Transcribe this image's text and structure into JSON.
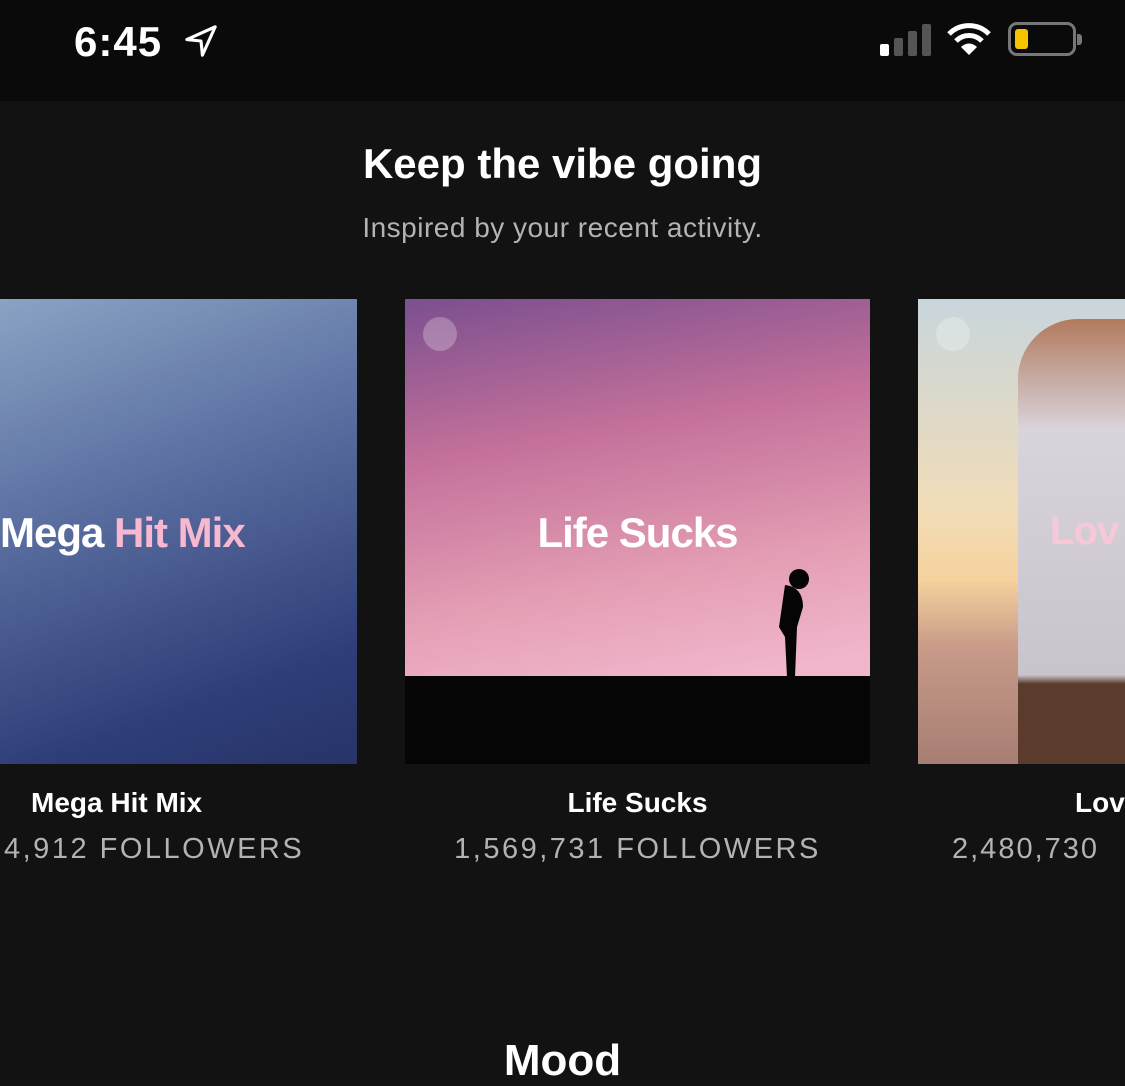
{
  "status_bar": {
    "time": "6:45",
    "battery_color": "#f5c400",
    "icons": [
      "location-arrow-icon",
      "signal-icon",
      "wifi-icon",
      "battery-icon"
    ]
  },
  "section": {
    "title": "Keep the vibe going",
    "subtitle": "Inspired by your recent activity."
  },
  "playlists": [
    {
      "cover_text_1": "Mega ",
      "cover_text_2": "Hit Mix",
      "title": "Mega Hit Mix",
      "followers": "4,912 FOLLOWERS"
    },
    {
      "cover_text": "Life Sucks",
      "title": "Life Sucks",
      "followers": "1,569,731 FOLLOWERS"
    },
    {
      "cover_text": "Lov",
      "title": "Lov",
      "followers": "2,480,730"
    }
  ],
  "next_section": {
    "title": "Mood"
  }
}
